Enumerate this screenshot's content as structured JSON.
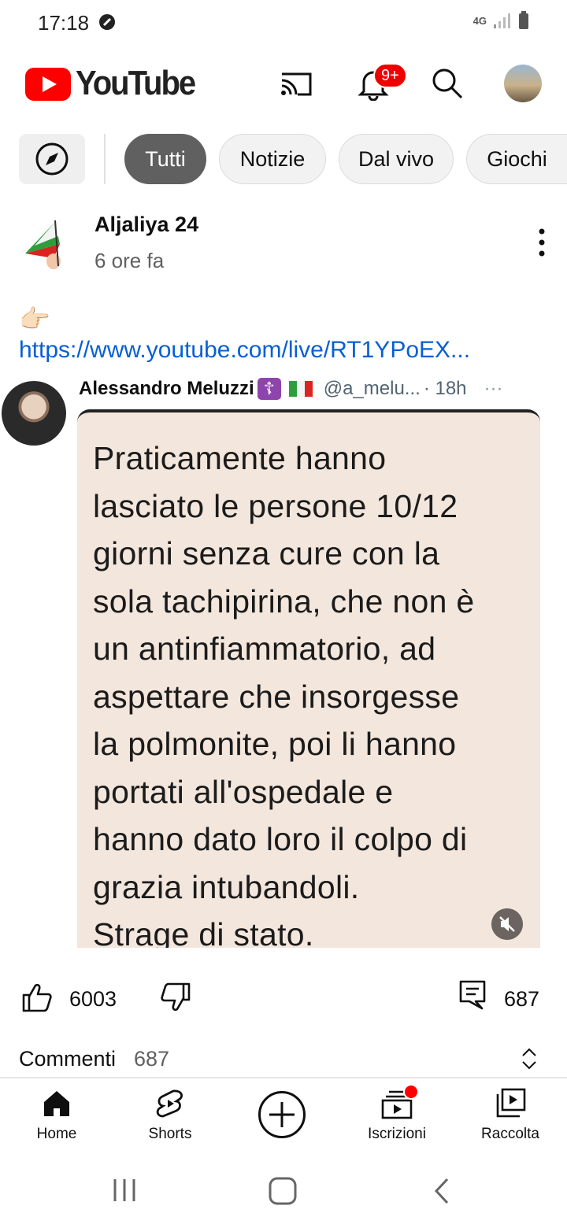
{
  "status_bar": {
    "time": "17:18",
    "network": "4G"
  },
  "header": {
    "logo_text": "YouTube",
    "notification_badge": "9+"
  },
  "chips": [
    {
      "label": "Tutti",
      "active": true
    },
    {
      "label": "Notizie",
      "active": false
    },
    {
      "label": "Dal vivo",
      "active": false
    },
    {
      "label": "Giochi",
      "active": false
    }
  ],
  "post": {
    "channel_name": "Aljaliya 24",
    "time": "6 ore fa",
    "emoji": "👉🏻",
    "link": "https://www.youtube.com/live/RT1YPoEX..."
  },
  "tweet": {
    "author": "Alessandro Meluzzi",
    "cross": "☦",
    "handle": "@a_melu...",
    "age": "· 18h",
    "dots": "···",
    "text": "Praticamente hanno\nlasciato le persone 10/12\ngiorni senza cure con la\nsola tachipirina, che non è\nun antinfiammatorio, ad\naspettare che insorgesse\nla polmonite, poi li hanno\nportati all'ospedale e\nhanno dato loro il colpo di\ngrazia intubandoli.\nStrage di stato."
  },
  "actions": {
    "likes": "6003",
    "comments": "687"
  },
  "comments_section": {
    "label": "Commenti",
    "count": "687"
  },
  "bottom_nav": {
    "home": "Home",
    "shorts": "Shorts",
    "subscriptions": "Iscrizioni",
    "library": "Raccolta"
  },
  "colors": {
    "brand_red": "#ff0000",
    "link_blue": "#065fd4",
    "tweet_bg": "#f3e6dc"
  }
}
